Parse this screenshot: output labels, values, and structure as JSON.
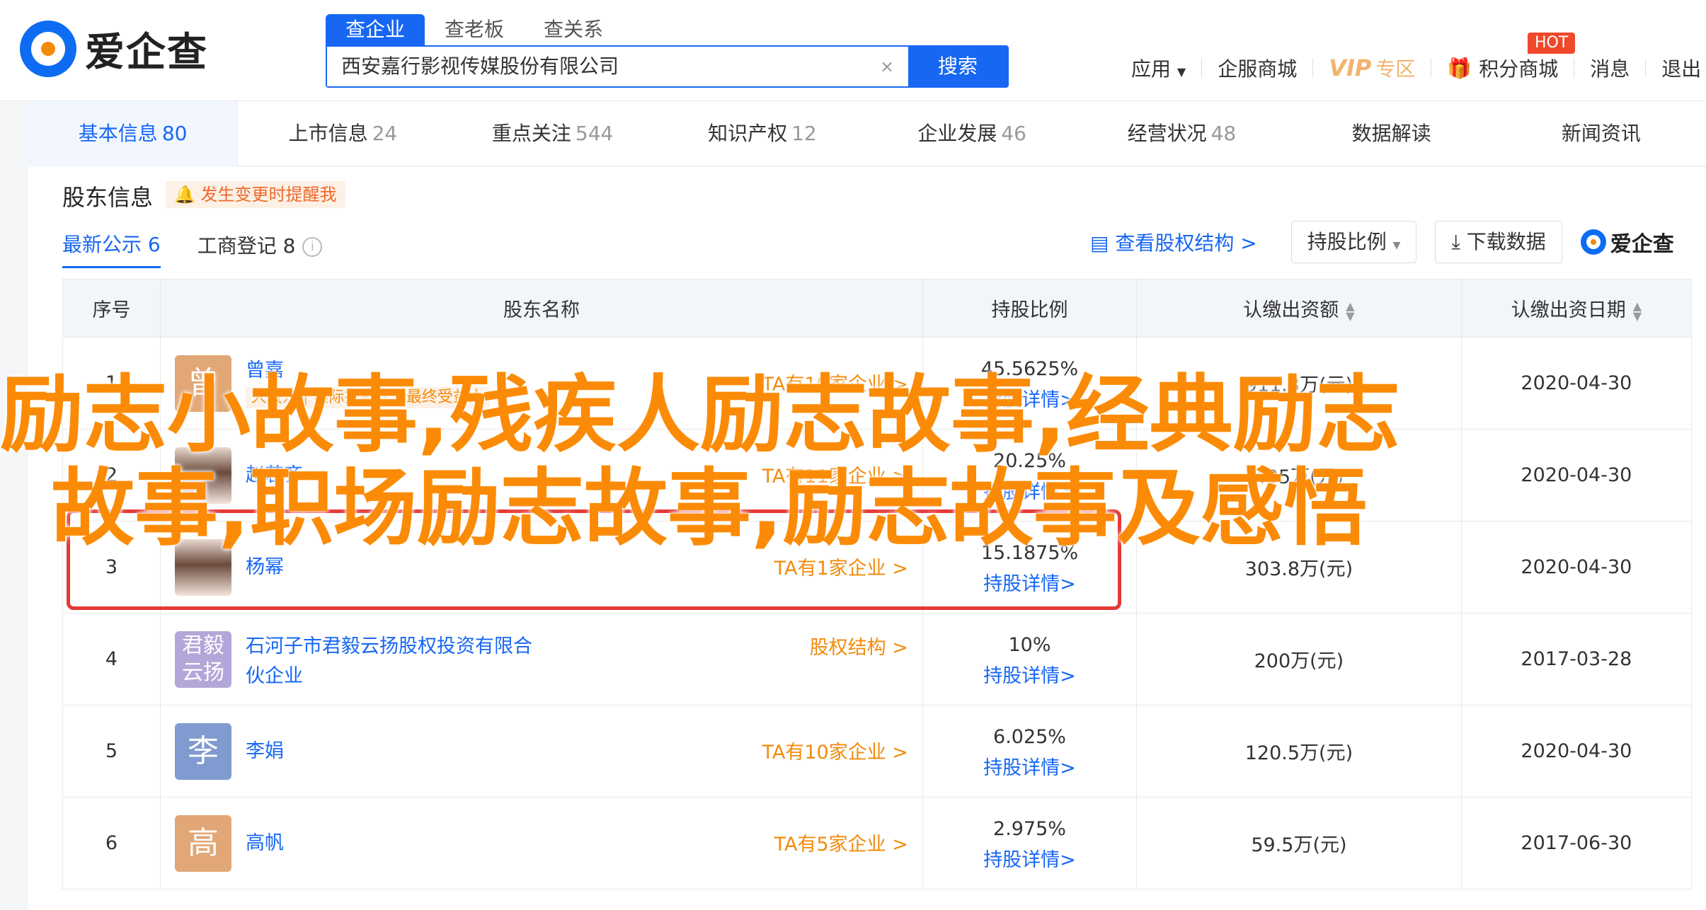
{
  "header": {
    "logo_text": "爱企查",
    "search_tabs": [
      "查企业",
      "查老板",
      "查关系"
    ],
    "search_value": "西安嘉行影视传媒股份有限公司",
    "clear_glyph": "×",
    "search_button": "搜索",
    "nav": {
      "apps": "应用",
      "mall": "企服商城",
      "vip": "VIP",
      "vip_zone": "专区",
      "points": "积分商城",
      "hot_badge": "HOT",
      "messages": "消息",
      "logout": "退出"
    }
  },
  "tabs": [
    {
      "label": "基本信息",
      "count": "80"
    },
    {
      "label": "上市信息",
      "count": "24"
    },
    {
      "label": "重点关注",
      "count": "544"
    },
    {
      "label": "知识产权",
      "count": "12"
    },
    {
      "label": "企业发展",
      "count": "46"
    },
    {
      "label": "经营状况",
      "count": "48"
    },
    {
      "label": "数据解读",
      "count": ""
    },
    {
      "label": "新闻资讯",
      "count": ""
    }
  ],
  "section": {
    "title": "股东信息",
    "remind": "发生变更时提醒我",
    "subtabs": [
      "最新公示 6",
      "工商登记 8"
    ],
    "info_glyph": "i",
    "view_structure": "查看股权结构 >",
    "ratio_button": "持股比例",
    "download_button": "下载数据",
    "brand": "爱企查"
  },
  "table": {
    "headers": [
      "序号",
      "股东名称",
      "持股比例",
      "认缴出资额",
      "认缴出资日期"
    ],
    "rows": [
      {
        "no": "1",
        "avatar": "曾",
        "avatar_color": "#e2a776",
        "name": "曾嘉",
        "tag": "大股东",
        "tag2": "实际控制人",
        "tag3": "最终受益人",
        "link": "TA有10家企业 >",
        "pct": "45.5625%",
        "detail": "持股详情>",
        "amount": "911.3万(元)",
        "date": "2020-04-30"
      },
      {
        "no": "2",
        "avatar": "",
        "avatar_color": "",
        "name": "赵若齐",
        "tag": "",
        "link": "TA有11家企业 >",
        "pct": "20.25%",
        "detail": "持股详情>",
        "amount": "405万(元)",
        "date": "2020-04-30"
      },
      {
        "no": "3",
        "avatar": "",
        "avatar_color": "",
        "name": "杨幂",
        "tag": "",
        "link": "TA有1家企业 >",
        "pct": "15.1875%",
        "detail": "持股详情>",
        "amount": "303.8万(元)",
        "date": "2020-04-30"
      },
      {
        "no": "4",
        "avatar": "君毅云扬",
        "avatar_color": "#b3a6d9",
        "name": "石河子市君毅云扬股权投资有限合伙企业",
        "tag": "",
        "link": "股权结构 >",
        "pct": "10%",
        "detail": "持股详情>",
        "amount": "200万(元)",
        "date": "2017-03-28"
      },
      {
        "no": "5",
        "avatar": "李",
        "avatar_color": "#7f9bcf",
        "name": "李娟",
        "tag": "",
        "link": "TA有10家企业 >",
        "pct": "6.025%",
        "detail": "持股详情>",
        "amount": "120.5万(元)",
        "date": "2020-04-30"
      },
      {
        "no": "6",
        "avatar": "高",
        "avatar_color": "#e2a776",
        "name": "高帆",
        "tag": "",
        "link": "TA有5家企业 >",
        "pct": "2.975%",
        "detail": "持股详情>",
        "amount": "59.5万(元)",
        "date": "2017-06-30"
      }
    ]
  },
  "overlay": {
    "line1": "励志小故事,残疾人励志故事,经典励志",
    "line2": "故事,职场励志故事,励志故事及感悟"
  },
  "colors": {
    "accent": "#1767f3",
    "orange": "#f28b0c",
    "overlay": "#fb8b06",
    "red": "#e53935"
  }
}
